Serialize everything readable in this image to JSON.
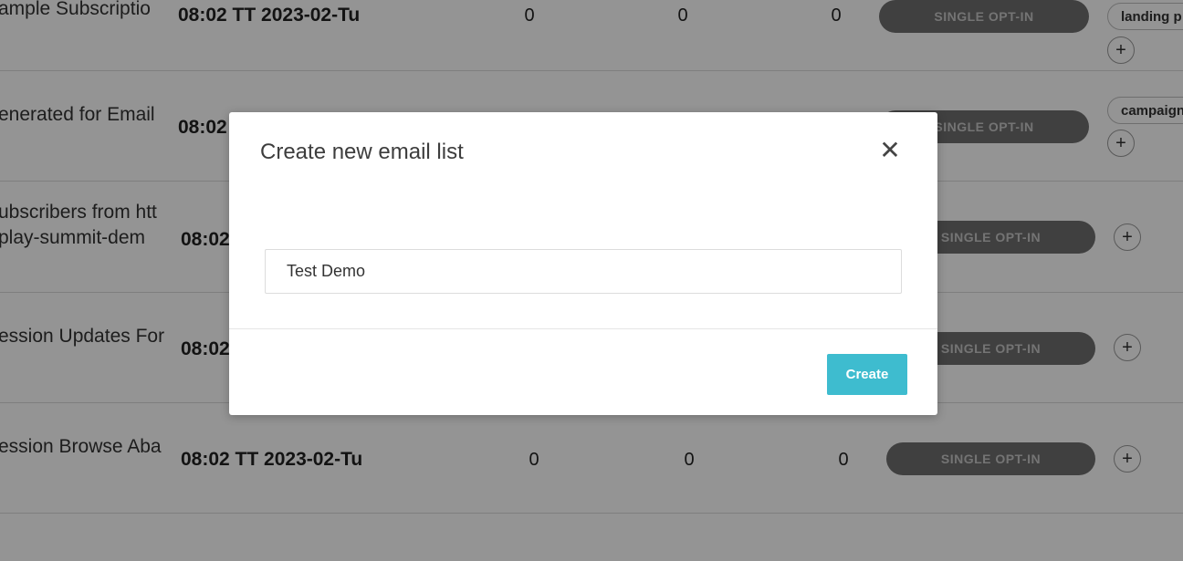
{
  "table": {
    "rows": [
      {
        "name_lines": [
          "ample Subscriptio"
        ],
        "date": "08:02 TT 2023-02-Tu",
        "count1": "0",
        "count2": "0",
        "count3": "0",
        "optin": "SINGLE OPT-IN",
        "tag": "landing p"
      },
      {
        "name_lines": [
          "enerated for Email"
        ],
        "date": "08:02",
        "count1": "",
        "count2": "",
        "count3": "",
        "optin": "SINGLE OPT-IN",
        "tag": "campaign"
      },
      {
        "name_lines": [
          "ubscribers from htt",
          "play-summit-dem"
        ],
        "date": "08:02",
        "count1": "",
        "count2": "",
        "count3": "",
        "optin": "SINGLE OPT-IN",
        "tag": ""
      },
      {
        "name_lines": [
          "ession Updates For"
        ],
        "date": "08:02",
        "count1": "",
        "count2": "",
        "count3": "",
        "optin": "SINGLE OPT-IN",
        "tag": ""
      },
      {
        "name_lines": [
          "ession Browse Aba"
        ],
        "date": "08:02 TT 2023-02-Tu",
        "count1": "0",
        "count2": "0",
        "count3": "0",
        "optin": "SINGLE OPT-IN",
        "tag": ""
      }
    ],
    "plus_symbol": "+"
  },
  "modal": {
    "title": "Create new email list",
    "close_symbol": "✕",
    "input_value": "Test Demo",
    "create_label": "Create"
  },
  "colors": {
    "overlay": "rgba(0,0,0,0.42)",
    "create_button": "#3ebccf",
    "optin_badge": "#6f6f6f"
  }
}
